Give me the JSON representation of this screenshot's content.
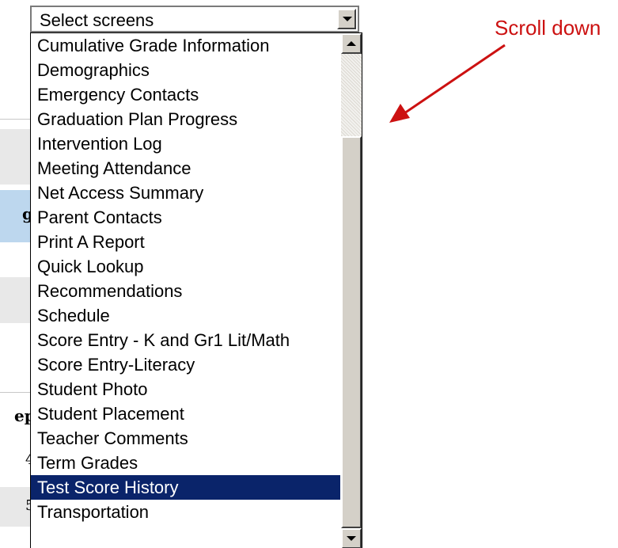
{
  "select": {
    "value": "Select screens",
    "options": [
      "Cumulative Grade Information",
      "Demographics",
      "Emergency Contacts",
      "Graduation Plan Progress",
      "Intervention Log",
      "Meeting Attendance",
      "Net Access Summary",
      "Parent Contacts",
      "Print A Report",
      "Quick Lookup",
      "Recommendations",
      "Schedule",
      "Score Entry - K and Gr1 Lit/Math",
      "Score Entry-Literacy",
      "Student Photo",
      "Student Placement",
      "Teacher Comments",
      "Term Grades",
      "Test Score History",
      "Transportation"
    ],
    "highlighted": "Test Score History"
  },
  "annotation": {
    "text": "Scroll down",
    "color": "#cc1111"
  },
  "background_fragments": {
    "frag1": "g",
    "frag2": "ep",
    "frag3": "4",
    "frag4": "5"
  },
  "colors": {
    "selection": "#0a246a",
    "highlight_panel": "#bdd7ee"
  },
  "icons": [
    "chevron-down-icon",
    "scroll-up-icon",
    "scroll-down-icon",
    "arrow-annotation-icon"
  ]
}
